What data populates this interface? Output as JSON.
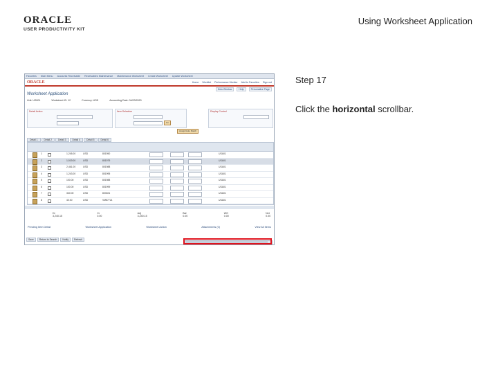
{
  "header": {
    "logo_main": "ORACLE",
    "logo_sub": "USER PRODUCTIVITY KIT",
    "doc_title": "Using Worksheet Application"
  },
  "step": {
    "label": "Step 17",
    "instruction_prefix": "Click the ",
    "instruction_bold": "horizontal",
    "instruction_suffix": " scrollbar."
  },
  "screenshot": {
    "top_links": [
      "Favorites",
      "Main Menu",
      "Accounts Receivable",
      "Receivables Maintenance",
      "Maintenance Worksheet",
      "Create Worksheet",
      "Update Worksheet"
    ],
    "brand": "ORACLE",
    "brand_links": [
      "Home",
      "Worklist",
      "Performance Monitor",
      "Add to Favorites",
      "Sign out"
    ],
    "nav_buttons": [
      "New Window",
      "Help",
      "Personalize Page"
    ],
    "page_title": "Worksheet Application",
    "subhead": [
      "Unit: US001",
      "Worksheet ID: 12",
      "Currency: USD",
      "Accounting Date: 04/03/2020"
    ],
    "detail_caption": "Detail Action",
    "item_caption": "Item Selection",
    "display_caption": "Display Control",
    "action_button": "Go",
    "auto_button": "Assign/Auto Match",
    "tabs": [
      "Detail 1",
      "Detail 2",
      "Detail 3",
      "Detail 4",
      "Detail 5",
      "Detail 6"
    ],
    "rows": [
      {
        "no": "1",
        "amt": "1,245.00",
        "cur": "USD",
        "item": "801950",
        "cust": "USA01"
      },
      {
        "no": "2",
        "amt": "1,919.00",
        "cur": "USD",
        "item": "801979",
        "cust": "USA01"
      },
      {
        "no": "3",
        "amt": "2,461.00",
        "cur": "USD",
        "item": "801988",
        "cust": "USA01"
      },
      {
        "no": "4",
        "amt": "1,243.00",
        "cur": "USD",
        "item": "801995",
        "cust": "USA01"
      },
      {
        "no": "5",
        "amt": "100.00",
        "cur": "USD",
        "item": "801988",
        "cust": "USA01"
      },
      {
        "no": "6",
        "amt": "100.00",
        "cur": "USD",
        "item": "801999",
        "cust": "USA01"
      },
      {
        "no": "7",
        "amt": "340.00",
        "cur": "USD",
        "item": "803021",
        "cust": "USA01"
      },
      {
        "no": "8",
        "amt": "40.00",
        "cur": "USD",
        "item": "VM87721",
        "cust": "USA01"
      }
    ],
    "totals": [
      "Dr 3,240.15",
      "Cr 0.00",
      "Adj 3,240.15",
      "Bal 0.00",
      "WO 0.00",
      "Net 0.00"
    ],
    "bottom_links": [
      "Pending Item Detail",
      "Worksheet Application",
      "Worksheet Action",
      "Attachments (0)",
      "View All Items"
    ],
    "bottom_actions": [
      "Save",
      "Return to Search",
      "Notify",
      "Refresh"
    ]
  }
}
